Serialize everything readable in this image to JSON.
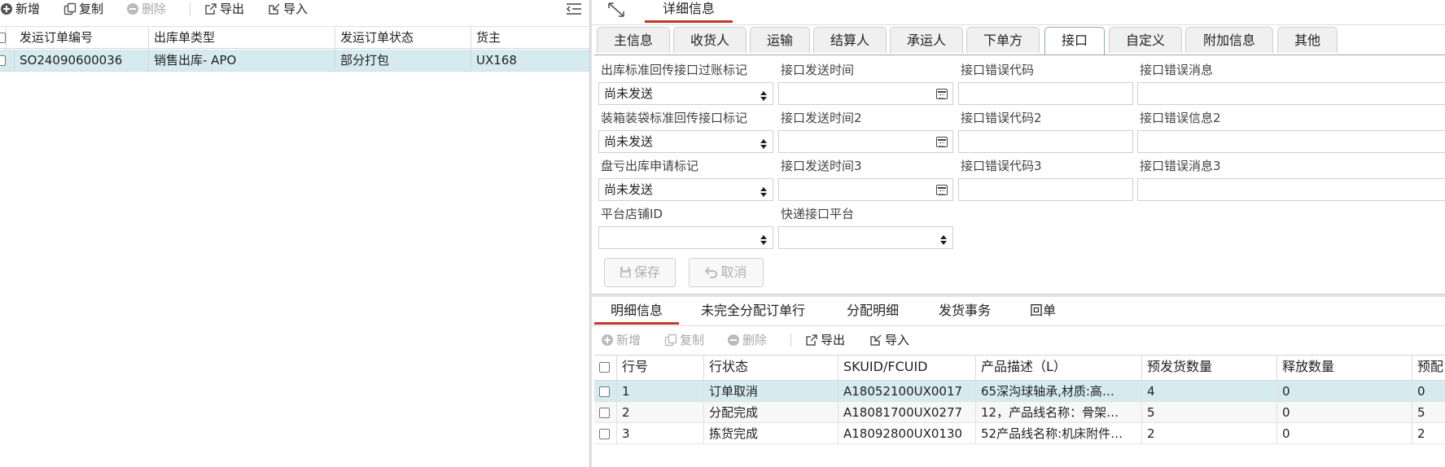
{
  "left_toolbar": {
    "add": "新增",
    "copy": "复制",
    "delete": "删除",
    "export": "导出",
    "import": "导入"
  },
  "order_grid": {
    "columns": [
      "发运订单编号",
      "出库单类型",
      "发运订单状态",
      "货主"
    ],
    "rows": [
      [
        "SO24090600036",
        "销售出库- APO",
        "部分打包",
        "UX168"
      ]
    ]
  },
  "detail_header": {
    "title": "详细信息"
  },
  "detail_tabs": [
    "主信息",
    "收货人",
    "运输",
    "结算人",
    "承运人",
    "下单方",
    "接口",
    "自定义",
    "附加信息",
    "其他"
  ],
  "interface_form": {
    "row1": {
      "flag_label": "出库标准回传接口过账标记",
      "flag_value": "尚未发送",
      "time_label": "接口发送时间",
      "code_label": "接口错误代码",
      "msg_label": "接口错误消息"
    },
    "row2": {
      "flag_label": "装箱装袋标准回传接口标记",
      "flag_value": "尚未发送",
      "time_label": "接口发送时间2",
      "code_label": "接口错误代码2",
      "msg_label": "接口错误信息2"
    },
    "row3": {
      "flag_label": "盘亏出库申请标记",
      "flag_value": "尚未发送",
      "time_label": "接口发送时间3",
      "code_label": "接口错误代码3",
      "msg_label": "接口错误消息3"
    },
    "row4": {
      "shop_label": "平台店铺ID",
      "express_label": "快递接口平台"
    },
    "save": "保存",
    "cancel": "取消"
  },
  "bottom_tabs": [
    "明细信息",
    "未完全分配订单行",
    "分配明细",
    "发货事务",
    "回单"
  ],
  "detail_toolbar": {
    "add": "新增",
    "copy": "复制",
    "delete": "删除",
    "export": "导出",
    "import": "导入"
  },
  "detail_grid": {
    "columns": [
      "行号",
      "行状态",
      "SKUID/FCUID",
      "产品描述（L）",
      "预发货数量",
      "释放数量",
      "预配"
    ],
    "rows": [
      [
        "1",
        "订单取消",
        "A18052100UX0017",
        "65深沟球轴承,材质:高…",
        "4",
        "0",
        "0"
      ],
      [
        "2",
        "分配完成",
        "A18081700UX0277",
        "12，产品线名称：骨架…",
        "5",
        "0",
        "5"
      ],
      [
        "3",
        "拣货完成",
        "A18092800UX0130",
        "52产品线名称:机床附件…",
        "2",
        "0",
        "2"
      ]
    ]
  },
  "colors": {
    "accent": "#c0392b",
    "selected_row": "#d5ebef"
  }
}
